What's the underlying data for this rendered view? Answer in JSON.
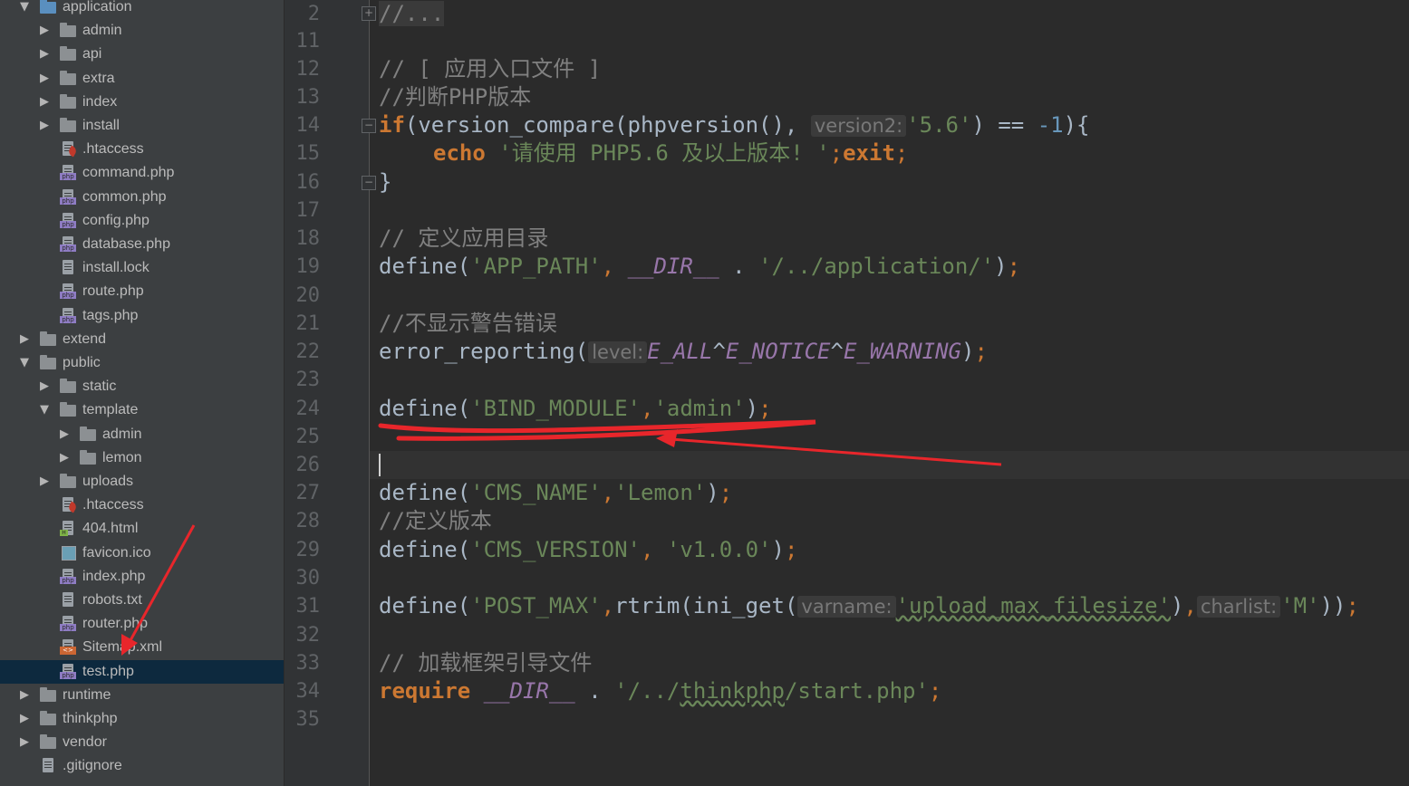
{
  "project_tree": {
    "items": [
      {
        "label": "application",
        "type": "folder",
        "open": true,
        "depth": 0,
        "icon": "folder-blue-icon"
      },
      {
        "label": "admin",
        "type": "folder",
        "open": false,
        "depth": 1,
        "icon": "folder-icon"
      },
      {
        "label": "api",
        "type": "folder",
        "open": false,
        "depth": 1,
        "icon": "folder-icon"
      },
      {
        "label": "extra",
        "type": "folder",
        "open": false,
        "depth": 1,
        "icon": "folder-icon"
      },
      {
        "label": "index",
        "type": "folder",
        "open": false,
        "depth": 1,
        "icon": "folder-icon"
      },
      {
        "label": "install",
        "type": "folder",
        "open": false,
        "depth": 1,
        "icon": "folder-icon"
      },
      {
        "label": ".htaccess",
        "type": "htaccess",
        "depth": 1,
        "icon": "htaccess-file-icon"
      },
      {
        "label": "command.php",
        "type": "php",
        "depth": 1,
        "icon": "php-file-icon"
      },
      {
        "label": "common.php",
        "type": "php",
        "depth": 1,
        "icon": "php-file-icon"
      },
      {
        "label": "config.php",
        "type": "php",
        "depth": 1,
        "icon": "php-file-icon"
      },
      {
        "label": "database.php",
        "type": "php",
        "depth": 1,
        "icon": "php-file-icon"
      },
      {
        "label": "install.lock",
        "type": "text",
        "depth": 1,
        "icon": "text-file-icon"
      },
      {
        "label": "route.php",
        "type": "php",
        "depth": 1,
        "icon": "php-file-icon"
      },
      {
        "label": "tags.php",
        "type": "php",
        "depth": 1,
        "icon": "php-file-icon"
      },
      {
        "label": "extend",
        "type": "folder",
        "open": false,
        "depth": 0,
        "icon": "folder-icon"
      },
      {
        "label": "public",
        "type": "folder",
        "open": true,
        "depth": 0,
        "icon": "folder-icon"
      },
      {
        "label": "static",
        "type": "folder",
        "open": false,
        "depth": 1,
        "icon": "folder-icon"
      },
      {
        "label": "template",
        "type": "folder",
        "open": true,
        "depth": 1,
        "icon": "folder-icon"
      },
      {
        "label": "admin",
        "type": "folder",
        "open": false,
        "depth": 2,
        "icon": "folder-icon"
      },
      {
        "label": "lemon",
        "type": "folder",
        "open": false,
        "depth": 2,
        "icon": "folder-icon"
      },
      {
        "label": "uploads",
        "type": "folder",
        "open": false,
        "depth": 1,
        "icon": "folder-icon"
      },
      {
        "label": ".htaccess",
        "type": "htaccess",
        "depth": 1,
        "icon": "htaccess-file-icon"
      },
      {
        "label": "404.html",
        "type": "html",
        "depth": 1,
        "icon": "html-file-icon"
      },
      {
        "label": "favicon.ico",
        "type": "ico",
        "depth": 1,
        "icon": "image-file-icon"
      },
      {
        "label": "index.php",
        "type": "php",
        "depth": 1,
        "icon": "php-file-icon"
      },
      {
        "label": "robots.txt",
        "type": "text",
        "depth": 1,
        "icon": "text-file-icon"
      },
      {
        "label": "router.php",
        "type": "php",
        "depth": 1,
        "icon": "php-file-icon"
      },
      {
        "label": "Sitemap.xml",
        "type": "xml",
        "depth": 1,
        "icon": "xml-file-icon"
      },
      {
        "label": "test.php",
        "type": "php",
        "depth": 1,
        "icon": "php-file-icon",
        "selected": true
      },
      {
        "label": "runtime",
        "type": "folder",
        "open": false,
        "depth": 0,
        "icon": "folder-icon"
      },
      {
        "label": "thinkphp",
        "type": "folder",
        "open": false,
        "depth": 0,
        "icon": "folder-icon"
      },
      {
        "label": "vendor",
        "type": "folder",
        "open": false,
        "depth": 0,
        "icon": "folder-icon"
      },
      {
        "label": ".gitignore",
        "type": "text",
        "depth": 0,
        "icon": "text-file-icon"
      }
    ],
    "file_tag_php": "php",
    "file_tag_html": "H",
    "file_tag_xml": "<>"
  },
  "editor": {
    "line_numbers": [
      "2",
      "11",
      "12",
      "13",
      "14",
      "15",
      "16",
      "17",
      "18",
      "19",
      "20",
      "21",
      "22",
      "23",
      "24",
      "25",
      "26",
      "27",
      "28",
      "29",
      "30",
      "31",
      "32",
      "33",
      "34",
      "35"
    ],
    "fold": {
      "collapsed_text": "//...",
      "expand_symbol": "+",
      "collapse_symbol": "−"
    },
    "lines": {
      "l12": "// [ 应用入口文件 ]",
      "l13": "//判断PHP版本",
      "l14_if": "if",
      "l14_fn": "(version_compare(phpversion(),",
      "l14_hint": "version2:",
      "l14_str": "'5.6'",
      "l14_op": ") == ",
      "l14_num": "-1",
      "l14_end": "){",
      "l15_echo": "echo",
      "l15_str": "'请使用 PHP5.6 及以上版本! '",
      "l15_semi": ";",
      "l15_exit": "exit",
      "l15_semi2": ";",
      "l16": "}",
      "l18": "// 定义应用目录",
      "l19_fn": "define(",
      "l19_str1": "'APP_PATH'",
      "l19_comma": ", ",
      "l19_const": "__DIR__",
      "l19_dot": " . ",
      "l19_str2": "'/../application/'",
      "l19_end": ")",
      "l19_semi": ";",
      "l21": "//不显示警告错误",
      "l22_fn": "error_reporting(",
      "l22_hint": "level:",
      "l22_c1": "E_ALL",
      "l22_op1": "^",
      "l22_c2": "E_NOTICE",
      "l22_op2": "^",
      "l22_c3": "E_WARNING",
      "l22_end": ")",
      "l22_semi": ";",
      "l24_fn": "define(",
      "l24_str1": "'BIND_MODULE'",
      "l24_comma": ",",
      "l24_str2": "'admin'",
      "l24_end": ")",
      "l24_semi": ";",
      "l27_fn": "define(",
      "l27_str1": "'CMS_NAME'",
      "l27_comma": ",",
      "l27_str2": "'Lemon'",
      "l27_end": ")",
      "l27_semi": ";",
      "l28": "//定义版本",
      "l29_fn": "define(",
      "l29_str1": "'CMS_VERSION'",
      "l29_comma": ", ",
      "l29_str2": "'v1.0.0'",
      "l29_end": ")",
      "l29_semi": ";",
      "l31_fn": "define(",
      "l31_str1": "'POST_MAX'",
      "l31_comma": ",",
      "l31_fn2": "rtrim(ini_get(",
      "l31_hint1": "varname:",
      "l31_str2": "'upload_max_filesize'",
      "l31_mid": ")",
      "l31_comma2": ",",
      "l31_hint2": "charlist:",
      "l31_str3": "'M'",
      "l31_end": "))",
      "l31_semi": ";",
      "l33": "// 加载框架引导文件",
      "l34_kw": "require",
      "l34_const": "__DIR__",
      "l34_dot": " . ",
      "l34_str_a": "'/../",
      "l34_str_b": "thinkphp",
      "l34_str_c": "/start.php'",
      "l34_semi": ";"
    }
  },
  "colors": {
    "annotation": "#e8262b",
    "keyword": "#cc7832",
    "string": "#6a8759",
    "constant": "#9876aa",
    "number": "#6897bb",
    "comment": "#808080"
  }
}
